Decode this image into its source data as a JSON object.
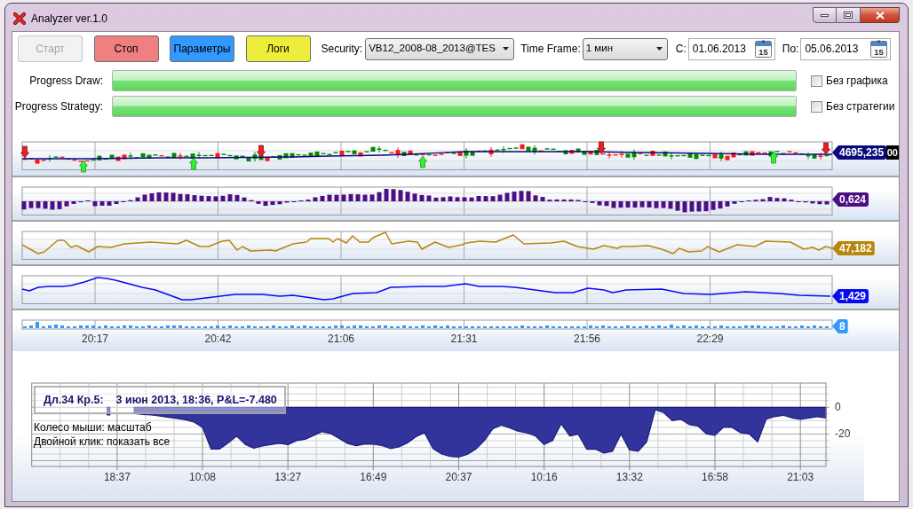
{
  "window": {
    "title": "Analyzer ver.1.0"
  },
  "toolbar": {
    "buttons": [
      {
        "label": "Старт",
        "color": "#f2f2f2",
        "disabled": true
      },
      {
        "label": "Стоп",
        "color": "#f08080",
        "disabled": false
      },
      {
        "label": "Параметры",
        "color": "#3399ff",
        "disabled": false
      },
      {
        "label": "Логи",
        "color": "#eded3b",
        "disabled": false
      }
    ],
    "security": {
      "label": "Security:",
      "value": "VB12_2008-08_2013@TES"
    },
    "time_frame": {
      "label": "Time Frame:",
      "value": "1 мин"
    },
    "date_from": {
      "label": "С:",
      "value": "01.06.2013",
      "calendar_day": "15"
    },
    "date_to": {
      "label": "По:",
      "value": "05.06.2013",
      "calendar_day": "15"
    }
  },
  "progress": [
    {
      "label": "Progress Draw:",
      "level": 1
    },
    {
      "label": "Progress Strategy:",
      "level": 1
    }
  ],
  "options": [
    {
      "label": "Без графика",
      "checked": false
    },
    {
      "label": "Без стратегии",
      "checked": false
    }
  ],
  "indicator_panels": [
    {
      "kind": "candles",
      "value": "4695,235",
      "second_value": "00",
      "color": "#0a0a7d"
    },
    {
      "kind": "histogram",
      "value": "0,624",
      "color": "#4d0e84"
    },
    {
      "kind": "line",
      "value": "47,182",
      "color": "#b8860b"
    },
    {
      "kind": "line",
      "value": "1,429",
      "color": "#0a0af0"
    },
    {
      "kind": "volume",
      "value": "8",
      "color": "#3399ff"
    }
  ],
  "time_axis": [
    "20:17",
    "20:42",
    "21:06",
    "21:31",
    "21:56",
    "22:29"
  ],
  "equity_chart": {
    "tooltip": {
      "trade": "Дл.34 Кр.5:",
      "details": "3 июн 2013, 18:36, P&L=-7.480"
    },
    "hints": [
      "Колесо мыши: масштаб",
      "Двойной клик: показать все"
    ],
    "chart_data": {
      "type": "area",
      "categories": [
        null,
        null,
        null,
        null,
        null,
        null,
        null,
        null,
        null,
        null,
        "18:37",
        null,
        null,
        null,
        null,
        null,
        null,
        null,
        null,
        null,
        "10:08",
        null,
        null,
        null,
        null,
        null,
        null,
        null,
        null,
        null,
        "13:27",
        null,
        null,
        null,
        null,
        null,
        null,
        null,
        null,
        null,
        "16:49",
        null,
        null,
        null,
        null,
        null,
        null,
        null,
        null,
        null,
        "20:37",
        null,
        null,
        null,
        null,
        null,
        null,
        null,
        null,
        null,
        "10:16",
        null,
        null,
        null,
        null,
        null,
        null,
        null,
        null,
        null,
        "13:32",
        null,
        null,
        null,
        null,
        null,
        null,
        null,
        null,
        null,
        "16:58",
        null,
        null,
        null,
        null,
        null,
        null,
        null,
        null,
        null,
        "21:03",
        null,
        null,
        null
      ],
      "values": [
        null,
        null,
        null,
        null,
        null,
        null,
        null,
        null,
        null,
        -5.8,
        null,
        null,
        -4.6,
        -5.3,
        -5.8,
        -6.5,
        -7.5,
        -8.4,
        -9.4,
        -11.1,
        -15,
        -31.3,
        -31.2,
        -26.8,
        -21.5,
        -27.8,
        -30.7,
        -28.9,
        -27.9,
        -27,
        -28,
        -25,
        -24,
        -21.2,
        -18.3,
        -19.7,
        -23.3,
        -27.2,
        -28.8,
        -27.5,
        -27.7,
        -28.7,
        -30.9,
        -29.6,
        -26.7,
        -22,
        -19,
        -31,
        -35,
        -36.8,
        -37.3,
        -35.3,
        -31.4,
        -24.9,
        -16,
        -13.4,
        -15.5,
        -18.1,
        -19.2,
        -21.6,
        -27.9,
        -24.9,
        -12.3,
        -21.5,
        -20.2,
        -31.4,
        -31.3,
        -34.3,
        -33,
        -20,
        -32,
        -33,
        -26,
        -2,
        -4,
        -10,
        -9,
        -13,
        -14,
        -20,
        -21,
        -15,
        -15,
        -19,
        -20,
        -26,
        -9,
        -7,
        -6,
        -8,
        -9,
        -8,
        -7,
        -8
      ],
      "ylim": [
        -44.3,
        18.1
      ],
      "yticks": [
        0,
        -20
      ],
      "grid": true
    }
  }
}
